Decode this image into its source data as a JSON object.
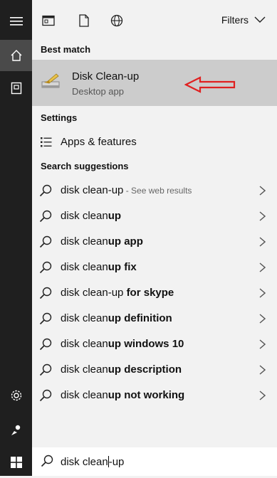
{
  "rail": {
    "items": [
      "menu-icon",
      "home-icon",
      "documents-icon",
      "settings-icon",
      "user-icon",
      "windows-icon"
    ]
  },
  "topbar": {
    "filters_label": "Filters"
  },
  "best_match": {
    "heading": "Best match",
    "title": "Disk Clean-up",
    "subtitle": "Desktop app"
  },
  "settings": {
    "heading": "Settings",
    "item_label": "Apps & features"
  },
  "suggestions": {
    "heading": "Search suggestions",
    "items": [
      {
        "normal": "disk clean-up",
        "bold": "",
        "extra": " - See web results"
      },
      {
        "normal": "disk clean",
        "bold": "up",
        "extra": ""
      },
      {
        "normal": "disk clean",
        "bold": "up app",
        "extra": ""
      },
      {
        "normal": "disk clean",
        "bold": "up fix",
        "extra": ""
      },
      {
        "normal": "disk clean-up ",
        "bold": "for skype",
        "extra": ""
      },
      {
        "normal": "disk clean",
        "bold": "up definition",
        "extra": ""
      },
      {
        "normal": "disk clean",
        "bold": "up windows 10",
        "extra": ""
      },
      {
        "normal": "disk clean",
        "bold": "up description",
        "extra": ""
      },
      {
        "normal": "disk clean",
        "bold": "up not working",
        "extra": ""
      }
    ]
  },
  "search": {
    "query_before_caret": "disk clean",
    "query_after_caret": "-up"
  },
  "colors": {
    "rail": "#1f1f1f",
    "panel": "#f2f2f2",
    "selected": "#cccccc",
    "arrow": "#e02020"
  }
}
